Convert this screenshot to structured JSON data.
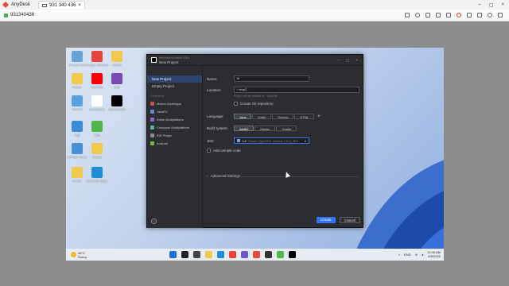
{
  "anydesk": {
    "app_name": "AnyDesk",
    "tab_label": "931 340 436",
    "session_id": "931340436"
  },
  "desktop": {
    "icons": [
      {
        "label": "Recycle Bin",
        "color": "#6aa2d8"
      },
      {
        "label": "Google Chrome",
        "color": "#e8443a"
      },
      {
        "label": "Folder",
        "color": "#f2c94c"
      },
      {
        "label": "Folder",
        "color": "#f2c94c"
      },
      {
        "label": "YouTube",
        "color": "#ff0000"
      },
      {
        "label": "App",
        "color": "#7a4ab3"
      },
      {
        "label": "This PC",
        "color": "#5aa0e0"
      },
      {
        "label": "Document",
        "color": "#ffffff"
      },
      {
        "label": "IntelliJ IDEA",
        "color": "#000000"
      },
      {
        "label": "App",
        "color": "#3b8dd6"
      },
      {
        "label": "App",
        "color": "#4fb848"
      },
      {
        "label": "Control Panel",
        "color": "#4a90d9"
      },
      {
        "label": "Folder",
        "color": "#f2c94c"
      },
      {
        "label": "Folder",
        "color": "#f2c94c"
      },
      {
        "label": "Microsoft Edge",
        "color": "#1e8fd6"
      },
      {
        "label": "App",
        "color": "#7a4ab3"
      },
      {
        "label": "App",
        "color": "#c33"
      }
    ]
  },
  "taskbar": {
    "weather_temp": "36°C",
    "weather_desc": "Sunny",
    "language": "ENG",
    "time": "12:40 AM",
    "date": "6/5/2022"
  },
  "dialog": {
    "app_title": "Welcome to IntelliJ IDEA",
    "title": "New Project",
    "sidebar": {
      "items": [
        "New Project",
        "Empty Project"
      ],
      "generators_heading": "Generators",
      "generators": [
        {
          "label": "Maven Archetype",
          "color": "#c75450"
        },
        {
          "label": "JavaFX",
          "color": "#5f8dd3"
        },
        {
          "label": "Kotlin Multiplatform",
          "color": "#8e63d8"
        },
        {
          "label": "Compose Multiplatform",
          "color": "#4cb8a0"
        },
        {
          "label": "IDE Plugin",
          "color": "#8c8c8c"
        },
        {
          "label": "Android",
          "color": "#7cb342"
        }
      ]
    },
    "form": {
      "name_label": "Name:",
      "name_value": "fe",
      "location_label": "Location:",
      "location_value": "~\\eop2",
      "location_hint": "Project will be created in: ~\\eop2\\fe",
      "git_label": "Create Git repository",
      "language_label": "Language:",
      "languages": [
        "Java",
        "Kotlin",
        "Groovy",
        "HTML"
      ],
      "language_selected": "Java",
      "build_label": "Build system:",
      "builds": [
        "IntelliJ",
        "Maven",
        "Gradle"
      ],
      "build_selected": "IntelliJ",
      "jdk_label": "JDK:",
      "jdk_value": "1.8",
      "jdk_detail": "Oracle OpenJDK version 1.8.0_352",
      "sample_label": "Add sample code",
      "advanced_label": "Advanced Settings"
    },
    "buttons": {
      "create": "Create",
      "cancel": "Cancel"
    }
  }
}
